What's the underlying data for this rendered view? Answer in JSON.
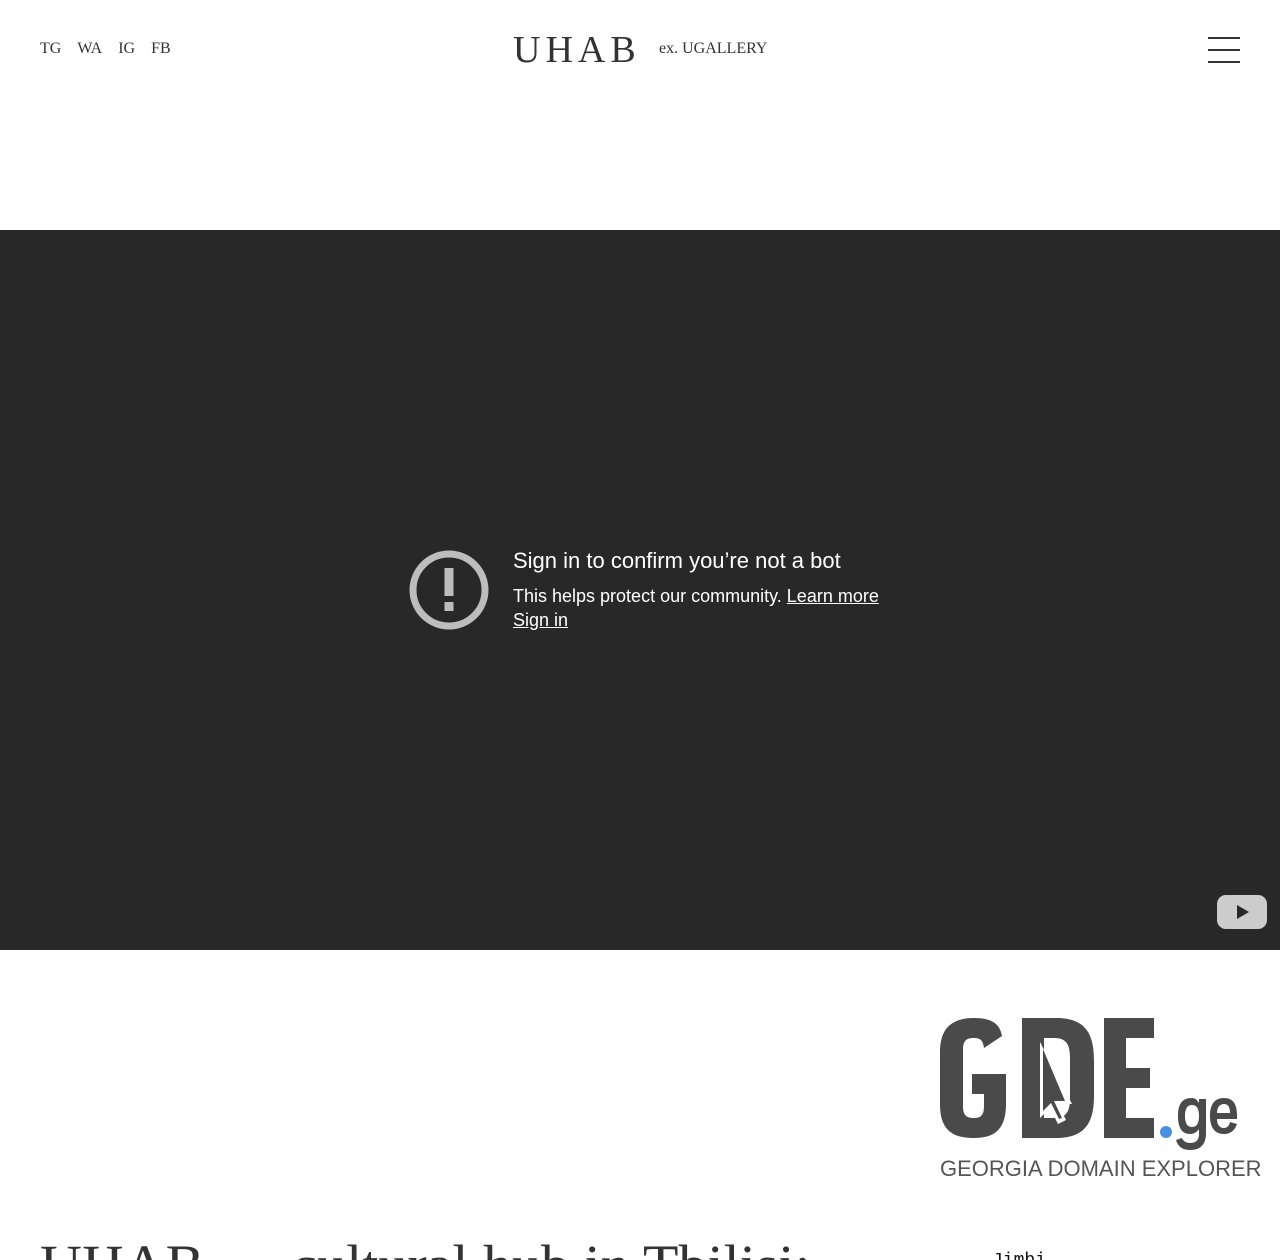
{
  "header": {
    "social": [
      {
        "label": "TG"
      },
      {
        "label": "WA"
      },
      {
        "label": "IG"
      },
      {
        "label": "FB"
      }
    ],
    "brand": "UHAB",
    "brand_sub": "ex. UGALLERY"
  },
  "video": {
    "title": "Sign in to confirm you’re not a bot",
    "description": "This helps protect our community.",
    "learn_more": "Learn more",
    "sign_in": "Sign in",
    "icon": "alert-icon",
    "player_logo": "youtube-icon"
  },
  "sponsor": {
    "logo_main": "GDE",
    "logo_tld": ".ge",
    "tagline": "GEORGIA DOMAIN EXPLORER",
    "colors": {
      "text": "#4a4a4a",
      "dot": "#4a90e2"
    }
  },
  "main": {
    "headline": "UHAB — cultural hub in Tbilisi:",
    "side_snippet": "Jimbi"
  }
}
